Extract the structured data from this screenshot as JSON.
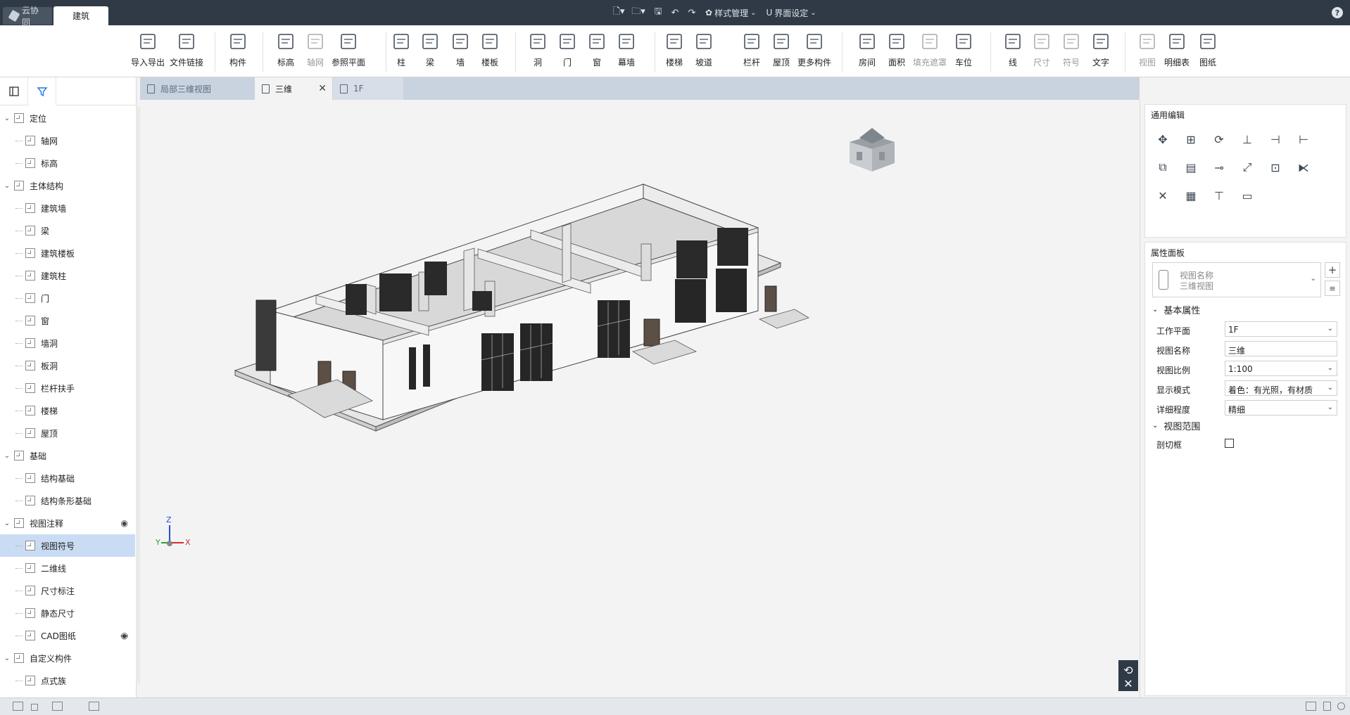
{
  "topbar": {
    "collab_tab": "云协同",
    "arch_tab": "建筑",
    "style_manage": "样式管理",
    "ui_settings": "界面设定",
    "help": "?"
  },
  "ribbon": {
    "buttons": [
      {
        "label": "导入导出",
        "icon": "cad-import-icon"
      },
      {
        "label": "文件链接",
        "icon": "file-link-icon"
      },
      {
        "label": "构件",
        "icon": "component-icon"
      },
      {
        "label": "标高",
        "icon": "level-icon"
      },
      {
        "label": "轴网",
        "icon": "grid-icon"
      },
      {
        "label": "参照平面",
        "icon": "reference-plane-icon"
      },
      {
        "label": "柱",
        "icon": "column-icon"
      },
      {
        "label": "梁",
        "icon": "beam-icon"
      },
      {
        "label": "墙",
        "icon": "wall-icon"
      },
      {
        "label": "楼板",
        "icon": "floor-icon"
      },
      {
        "label": "洞",
        "icon": "opening-icon"
      },
      {
        "label": "门",
        "icon": "door-icon"
      },
      {
        "label": "窗",
        "icon": "window-icon"
      },
      {
        "label": "幕墙",
        "icon": "curtain-wall-icon"
      },
      {
        "label": "楼梯",
        "icon": "stair-icon"
      },
      {
        "label": "坡道",
        "icon": "ramp-icon"
      },
      {
        "label": "栏杆",
        "icon": "railing-icon"
      },
      {
        "label": "屋顶",
        "icon": "roof-icon"
      },
      {
        "label": "更多构件",
        "icon": "more-components-icon"
      },
      {
        "label": "房间",
        "icon": "room-icon"
      },
      {
        "label": "面积",
        "icon": "area-icon"
      },
      {
        "label": "填充遮罩",
        "icon": "fill-mask-icon"
      },
      {
        "label": "车位",
        "icon": "parking-icon"
      },
      {
        "label": "线",
        "icon": "line-icon"
      },
      {
        "label": "尺寸",
        "icon": "dimension-icon"
      },
      {
        "label": "符号",
        "icon": "symbol-icon"
      },
      {
        "label": "文字",
        "icon": "text-icon"
      },
      {
        "label": "视图",
        "icon": "view-icon"
      },
      {
        "label": "明细表",
        "icon": "schedule-icon"
      },
      {
        "label": "图纸",
        "icon": "sheet-icon"
      }
    ]
  },
  "tree": {
    "items": [
      {
        "label": "定位",
        "level": 0
      },
      {
        "label": "轴网",
        "level": 1
      },
      {
        "label": "标高",
        "level": 1
      },
      {
        "label": "主体结构",
        "level": 0
      },
      {
        "label": "建筑墙",
        "level": 1
      },
      {
        "label": "梁",
        "level": 1
      },
      {
        "label": "建筑楼板",
        "level": 1
      },
      {
        "label": "建筑柱",
        "level": 1
      },
      {
        "label": "门",
        "level": 1
      },
      {
        "label": "窗",
        "level": 1
      },
      {
        "label": "墙洞",
        "level": 1
      },
      {
        "label": "板洞",
        "level": 1
      },
      {
        "label": "栏杆扶手",
        "level": 1
      },
      {
        "label": "楼梯",
        "level": 1
      },
      {
        "label": "屋顶",
        "level": 1
      },
      {
        "label": "基础",
        "level": 0
      },
      {
        "label": "结构基础",
        "level": 1
      },
      {
        "label": "结构条形基础",
        "level": 1
      },
      {
        "label": "视图注释",
        "level": 0
      },
      {
        "label": "视图符号",
        "level": 1
      },
      {
        "label": "二维线",
        "level": 1
      },
      {
        "label": "尺寸标注",
        "level": 1
      },
      {
        "label": "静态尺寸",
        "level": 1
      },
      {
        "label": "CAD图纸",
        "level": 1
      },
      {
        "label": "自定义构件",
        "level": 0
      },
      {
        "label": "点式族",
        "level": 1
      }
    ]
  },
  "tabs": [
    {
      "label": "局部三维视图",
      "active": false
    },
    {
      "label": "三维",
      "active": true
    },
    {
      "label": "1F",
      "active": false
    }
  ],
  "right": {
    "edit_title": "通用编辑",
    "props_title": "属性面板",
    "view_type_name": "视图名称",
    "view_type_sub": "三维视图",
    "basic_section": "基本属性",
    "range_section": "视图范围",
    "props": [
      {
        "key": "工作平面",
        "value": "1F",
        "dropdown": true
      },
      {
        "key": "视图名称",
        "value": "三维",
        "dropdown": false
      },
      {
        "key": "视图比例",
        "value": "1:100",
        "dropdown": true
      },
      {
        "key": "显示模式",
        "value": "着色：有光照，有材质",
        "dropdown": true
      },
      {
        "key": "详细程度",
        "value": "精细",
        "dropdown": true
      }
    ],
    "section_box_label": "剖切框"
  },
  "axes": {
    "x": "X",
    "y": "Y",
    "z": "Z"
  },
  "colors": {
    "topbar": "#2f3a46",
    "selection": "#c9dcf4",
    "tabbar": "#c9d3df",
    "accent": "#1f7ae0"
  }
}
